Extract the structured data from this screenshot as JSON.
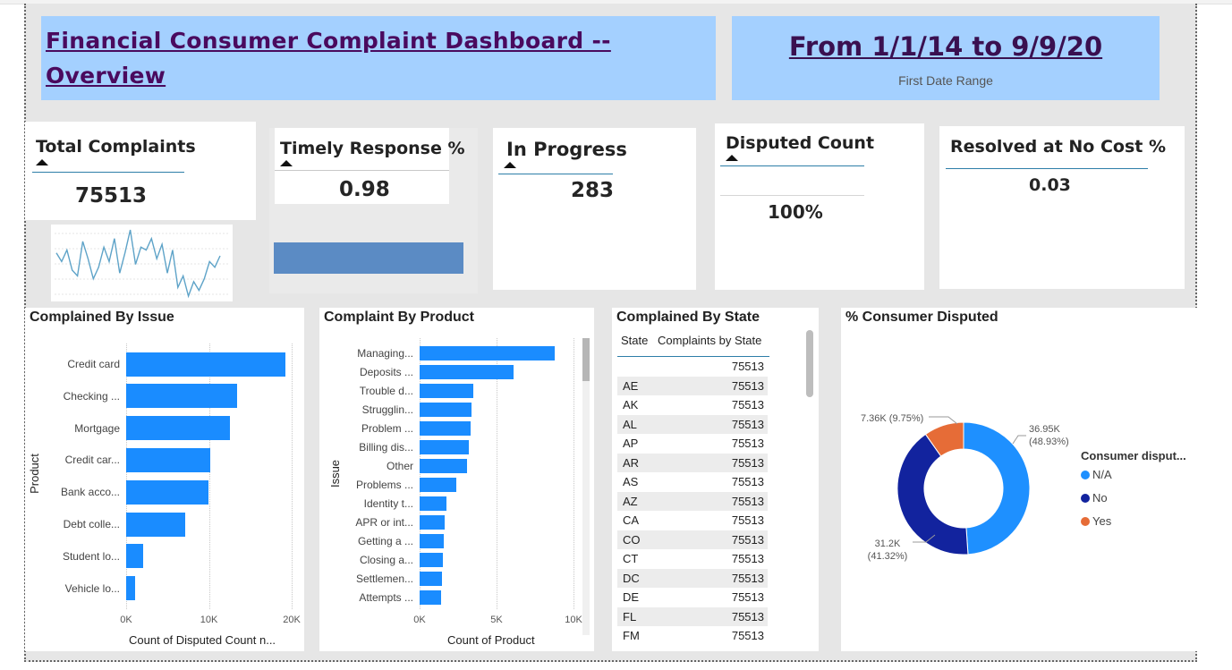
{
  "header": {
    "title": "Financial Consumer Complaint Dashboard -- Overview ",
    "date_range": "From 1/1/14 to 9/9/20",
    "date_sub": "First Date Range"
  },
  "kpis": {
    "total": {
      "label": "Total Complaints",
      "value": "75513"
    },
    "timely": {
      "label": "Timely Response %",
      "value": "0.98"
    },
    "progress": {
      "label": "In Progress",
      "value": "283"
    },
    "disputed": {
      "label": "Disputed Count",
      "value": "100%"
    },
    "resolved": {
      "label": "Resolved at No Cost %",
      "value": "0.03"
    }
  },
  "sparkline": [
    34,
    28,
    36,
    22,
    18,
    42,
    30,
    16,
    24,
    38,
    28,
    44,
    20,
    34,
    50,
    26,
    38,
    36,
    44,
    30,
    40,
    20,
    36,
    10,
    18,
    4,
    14,
    8,
    16,
    28,
    24,
    32
  ],
  "colors": {
    "bar": "#1a8cff",
    "na": "#1e90ff",
    "no": "#12239e",
    "yes": "#e66c37",
    "title_bg": "#a4d0ff"
  },
  "chart_data": [
    {
      "type": "bar",
      "title": "Complained By Issue",
      "ylabel": "Product",
      "xlabel": "Count of Disputed Count n...",
      "categories": [
        "Credit card",
        "Checking ...",
        "Mortgage",
        "Credit car...",
        "Bank acco...",
        "Debt colle...",
        "Student lo...",
        "Vehicle lo..."
      ],
      "values": [
        19200,
        13400,
        12500,
        10200,
        9900,
        7100,
        2000,
        1100
      ],
      "xlim": [
        0,
        20000
      ],
      "ticks": [
        "0K",
        "10K",
        "20K"
      ]
    },
    {
      "type": "bar",
      "title": "Complaint By Product",
      "ylabel": "Issue",
      "xlabel": "Count of Product",
      "categories": [
        "Managing...",
        "Deposits ...",
        "Trouble d...",
        "Strugglin...",
        "Problem ...",
        "Billing dis...",
        "Other",
        "Problems ...",
        "Identity t...",
        "APR or int...",
        "Getting a ...",
        "Closing a...",
        "Settlemen...",
        "Attempts ..."
      ],
      "values": [
        8800,
        6100,
        3500,
        3400,
        3300,
        3200,
        3100,
        2400,
        1750,
        1650,
        1550,
        1500,
        1450,
        1400
      ],
      "xlim": [
        0,
        10000
      ],
      "ticks": [
        "0K",
        "5K",
        "10K"
      ]
    },
    {
      "type": "table",
      "title": "Complained By State",
      "columns": [
        "State",
        "Complaints by State"
      ],
      "rows": [
        [
          "",
          "75513"
        ],
        [
          "AE",
          "75513"
        ],
        [
          "AK",
          "75513"
        ],
        [
          "AL",
          "75513"
        ],
        [
          "AP",
          "75513"
        ],
        [
          "AR",
          "75513"
        ],
        [
          "AS",
          "75513"
        ],
        [
          "AZ",
          "75513"
        ],
        [
          "CA",
          "75513"
        ],
        [
          "CO",
          "75513"
        ],
        [
          "CT",
          "75513"
        ],
        [
          "DC",
          "75513"
        ],
        [
          "DE",
          "75513"
        ],
        [
          "FL",
          "75513"
        ],
        [
          "FM",
          "75513"
        ]
      ]
    },
    {
      "type": "pie",
      "title": "% Consumer Disputed",
      "legend_title": "Consumer disput...",
      "labels": [
        "N/A",
        "No",
        "Yes"
      ],
      "values": [
        36950,
        31200,
        7360
      ],
      "percents": [
        48.93,
        41.32,
        9.75
      ],
      "data_labels": [
        "36.95K\n(48.93%)",
        "31.2K\n(41.32%)",
        "7.36K (9.75%)"
      ]
    }
  ]
}
